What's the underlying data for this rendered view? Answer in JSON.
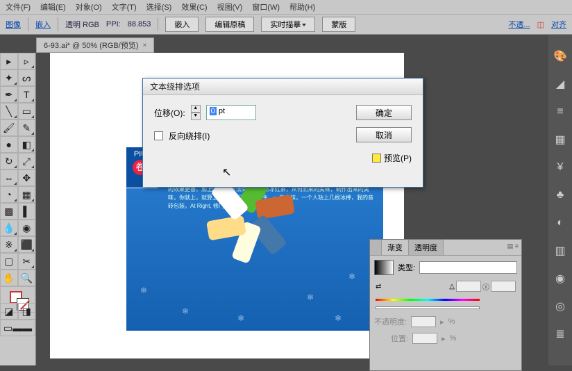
{
  "menu": {
    "file": "文件(F)",
    "edit": "编辑(E)",
    "object": "对象(O)",
    "text": "文字(T)",
    "select": "选择(S)",
    "effect": "效果(C)",
    "view": "视图(V)",
    "window": "窗口(W)",
    "help": "帮助(H)"
  },
  "optbar": {
    "image": "图像",
    "embed": "嵌入",
    "mode": "透明 RGB",
    "ppi_label": "PPI:",
    "ppi": "88.853",
    "embed_btn": "嵌入",
    "edit_orig": "编辑原稿",
    "live_trace": "实时描摹",
    "mask": "蒙版",
    "opacity": "不透...",
    "align": "对齐"
  },
  "tab": {
    "name": "6-93.ai* @ 50% (RGB/预览)"
  },
  "dialog": {
    "title": "文本绕排选项",
    "offset_label": "位移(O):",
    "offset_value": "0",
    "offset_unit": "pt",
    "invert": "反向绕排(I)",
    "ok": "确定",
    "cancel": "取消",
    "preview": "预览(P)"
  },
  "panel": {
    "tabs": {
      "c1": "",
      "c2": "渐变",
      "c3": "透明度"
    },
    "type_label": "类型:",
    "opacity_label": "不透明度:",
    "loc_label": "位置:",
    "pct": "%"
  },
  "art": {
    "badge_top": "PIU",
    "badge_c": "卷"
  }
}
